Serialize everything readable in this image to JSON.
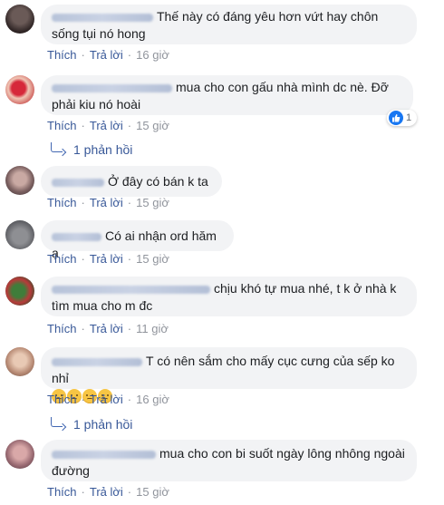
{
  "colors": {
    "link": "#385898",
    "meta": "#90949c",
    "bubble": "#f2f3f5",
    "like_blue": "#1877f2"
  },
  "comments": [
    {
      "author": "Huỳnh Thanh Vân",
      "text": "Thế này có đáng yêu hơn vứt hay chôn sống tụi nó hong",
      "like": "Thích",
      "reply": "Trả lời",
      "time": "16 giờ"
    },
    {
      "author": "Linh Nguyen Le Hieu",
      "text": "mua cho con gấu nhà mình dc nè. Đỡ phải kiu nó hoài",
      "like": "Thích",
      "reply": "Trả lời",
      "time": "15 giờ",
      "reaction_count": "1",
      "replies_label": "1 phản hồi"
    },
    {
      "author": "Trang Lâm",
      "text": "Ở đây có bán k ta",
      "like": "Thích",
      "reply": "Trả lời",
      "time": "15 giờ"
    },
    {
      "author": "Linh Lanh",
      "text": "Có ai nhận ord hăm ạ",
      "like": "Thích",
      "reply": "Trả lời",
      "time": "15 giờ"
    },
    {
      "author": "Trần Phương Thảo Nguyễn Le",
      "text": "chịu khó tự mua nhé, t k ở nhà k tìm mua cho m đc",
      "like": "Thích",
      "reply": "Trả lời",
      "time": "11 giờ"
    },
    {
      "author": "Nguyễn Thanh",
      "text": "T có nên sắm cho mấy cục cưng của sếp ko nhỉ",
      "like": "Thích",
      "reply": "Trả lời",
      "time": "16 giờ",
      "emoji_icons": [
        "thinking-face-icon",
        "thinking-face-icon",
        "thinking-face-icon",
        "thinking-face-icon"
      ],
      "replies_label": "1 phản hồi"
    },
    {
      "author": "Diep Anh Ngoc Bảo",
      "text": "mua cho con bi suốt ngày lông nhông ngoài đường",
      "like": "Thích",
      "reply": "Trả lời",
      "time": "15 giờ"
    }
  ]
}
